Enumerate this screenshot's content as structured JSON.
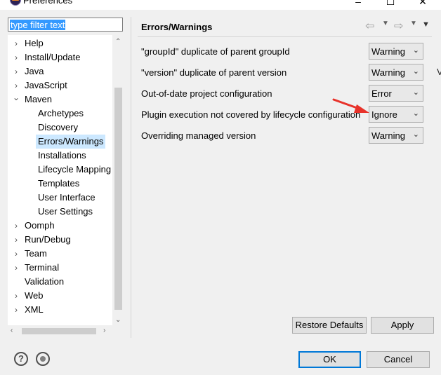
{
  "window": {
    "title": "Preferences",
    "minimize": "–",
    "maximize": "☐",
    "close": "✕"
  },
  "filter": {
    "value": "type filter text"
  },
  "tree": {
    "items": [
      {
        "label": "Help",
        "twisty": "›"
      },
      {
        "label": "Install/Update",
        "twisty": "›"
      },
      {
        "label": "Java",
        "twisty": "›"
      },
      {
        "label": "JavaScript",
        "twisty": "›"
      },
      {
        "label": "Maven",
        "twisty": "⌄"
      },
      {
        "label": "Archetypes",
        "twisty": ""
      },
      {
        "label": "Discovery",
        "twisty": ""
      },
      {
        "label": "Errors/Warnings",
        "twisty": "",
        "selected": true
      },
      {
        "label": "Installations",
        "twisty": ""
      },
      {
        "label": "Lifecycle Mapping",
        "twisty": ""
      },
      {
        "label": "Templates",
        "twisty": ""
      },
      {
        "label": "User Interface",
        "twisty": ""
      },
      {
        "label": "User Settings",
        "twisty": ""
      },
      {
        "label": "Oomph",
        "twisty": "›"
      },
      {
        "label": "Run/Debug",
        "twisty": "›"
      },
      {
        "label": "Team",
        "twisty": "›"
      },
      {
        "label": "Terminal",
        "twisty": "›"
      },
      {
        "label": "Validation",
        "twisty": ""
      },
      {
        "label": "Web",
        "twisty": "›"
      },
      {
        "label": "XML",
        "twisty": "›"
      }
    ]
  },
  "page": {
    "title": "Errors/Warnings",
    "options": [
      {
        "label": "\"groupId\" duplicate of parent groupId",
        "value": "Warning"
      },
      {
        "label": "\"version\" duplicate of parent version",
        "value": "Warning"
      },
      {
        "label": "Out-of-date project configuration",
        "value": "Error"
      },
      {
        "label": "Plugin execution not covered by lifecycle configuration",
        "value": "Ignore"
      },
      {
        "label": "Overriding managed version",
        "value": "Warning"
      }
    ],
    "restore_defaults": "Restore Defaults",
    "apply": "Apply"
  },
  "footer": {
    "help_glyph": "?",
    "ok": "OK",
    "cancel": "Cancel"
  },
  "right_edge_glyph": "V",
  "colors": {
    "selection": "#cce8ff",
    "filter_highlight": "#3399ff",
    "annotation_arrow": "#e8322a",
    "primary_border": "#0078d7"
  }
}
